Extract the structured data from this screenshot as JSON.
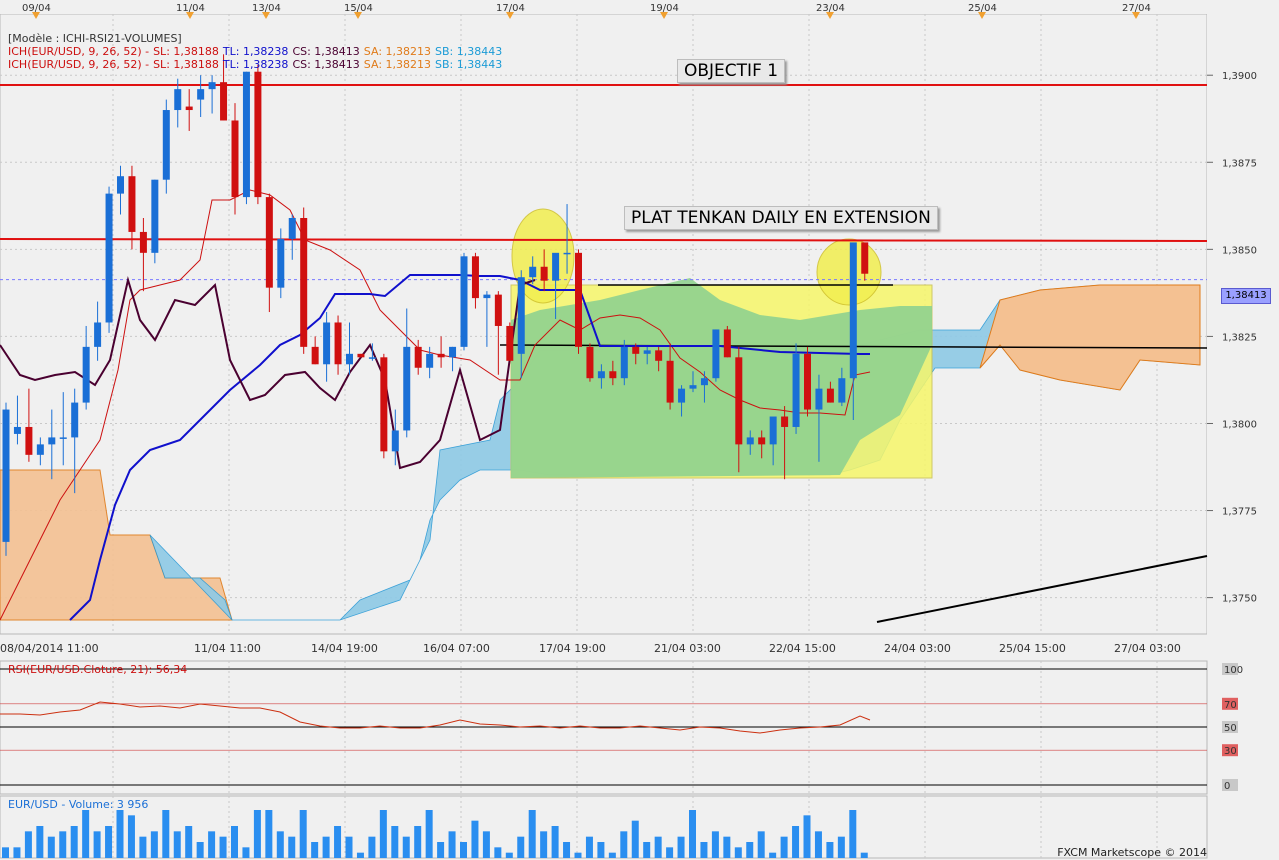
{
  "header": {
    "model": "[Modèle : ICHI-RSI21-VOLUMES]",
    "ich_line": {
      "name": "ICH(EUR/USD, 9, 26, 52) -",
      "sl": "SL: 1,38188",
      "tl": "TL: 1,38238",
      "cs": "CS: 1,38413",
      "sa": "SA: 1,38213",
      "sb": "SB: 1,38443"
    }
  },
  "annotations": {
    "objectif": "OBJECTIF 1",
    "plat_tenkan": "PLAT TENKAN DAILY EN EXTENSION"
  },
  "rsi_label": "RSI(EUR/USD.Cloture, 21): 56,34",
  "volume_label": "EUR/USD - Volume: 3 956",
  "footer": "FXCM Marketscope © 2014",
  "current_price_label": "1,38413",
  "colors": {
    "bull": "#1a6fd6",
    "bear": "#d01010",
    "kumo_bull": "#8ecae6",
    "kumo_bear": "#f4c192",
    "tenkan": "#cc1010",
    "kijun": "#1010cc",
    "chikou": "#4a0030",
    "highlight_yellow": "#f7f76a",
    "highlight_green": "#8fd18f",
    "objective_line": "#e01010"
  },
  "chart_data": [
    {
      "type": "candlestick",
      "top_dates": [
        "09/04",
        "11/04",
        "13/04",
        "15/04",
        "17/04",
        "19/04",
        "23/04",
        "25/04",
        "27/04"
      ],
      "x_tick_labels": [
        "08/04/2014 11:00",
        "11/04 11:00",
        "14/04 19:00",
        "16/04 07:00",
        "17/04 19:00",
        "21/04 03:00",
        "22/04 15:00",
        "24/04 03:00",
        "25/04 15:00",
        "27/04 03:00"
      ],
      "y_tick_labels": [
        "1,3900",
        "1,3875",
        "1,3850",
        "1,3825",
        "1,3800",
        "1,3775",
        "1,3750"
      ],
      "ylim": [
        1.3743,
        1.3917
      ],
      "ohlc": [
        [
          1.3766,
          1.3806,
          1.3762,
          1.3804
        ],
        [
          1.3797,
          1.3808,
          1.3794,
          1.3799
        ],
        [
          1.3799,
          1.381,
          1.3789,
          1.3791
        ],
        [
          1.3791,
          1.3796,
          1.3788,
          1.3794
        ],
        [
          1.3794,
          1.3804,
          1.3784,
          1.3796
        ],
        [
          1.3796,
          1.3809,
          1.3788,
          1.3796
        ],
        [
          1.3796,
          1.381,
          1.378,
          1.3806
        ],
        [
          1.3806,
          1.3828,
          1.3804,
          1.3822
        ],
        [
          1.3822,
          1.3835,
          1.3818,
          1.3829
        ],
        [
          1.3829,
          1.3868,
          1.3826,
          1.3866
        ],
        [
          1.3866,
          1.3874,
          1.386,
          1.3871
        ],
        [
          1.3871,
          1.3874,
          1.385,
          1.3855
        ],
        [
          1.3855,
          1.3859,
          1.3838,
          1.3849
        ],
        [
          1.3849,
          1.387,
          1.3846,
          1.387
        ],
        [
          1.387,
          1.3893,
          1.3866,
          1.389
        ],
        [
          1.389,
          1.3899,
          1.3885,
          1.3896
        ],
        [
          1.3891,
          1.3896,
          1.3884,
          1.389
        ],
        [
          1.3893,
          1.39,
          1.3888,
          1.3896
        ],
        [
          1.3896,
          1.39,
          1.3889,
          1.3898
        ],
        [
          1.3898,
          1.3906,
          1.3887,
          1.3887
        ],
        [
          1.3887,
          1.3892,
          1.386,
          1.3865
        ],
        [
          1.3865,
          1.3901,
          1.3863,
          1.3901
        ],
        [
          1.3901,
          1.3903,
          1.3863,
          1.3865
        ],
        [
          1.3865,
          1.3866,
          1.3832,
          1.3839
        ],
        [
          1.3839,
          1.3856,
          1.3836,
          1.3853
        ],
        [
          1.3853,
          1.386,
          1.3847,
          1.3859
        ],
        [
          1.3859,
          1.3862,
          1.382,
          1.3822
        ],
        [
          1.3822,
          1.3825,
          1.3817,
          1.3817
        ],
        [
          1.3817,
          1.3832,
          1.3812,
          1.3829
        ],
        [
          1.3829,
          1.3831,
          1.3814,
          1.3817
        ],
        [
          1.3817,
          1.3829,
          1.3814,
          1.382
        ],
        [
          1.382,
          1.382,
          1.3819,
          1.3819
        ],
        [
          1.3819,
          1.3823,
          1.3818,
          1.3819
        ],
        [
          1.3819,
          1.382,
          1.379,
          1.3792
        ],
        [
          1.3792,
          1.3804,
          1.3788,
          1.3798
        ],
        [
          1.3798,
          1.3833,
          1.3796,
          1.3822
        ],
        [
          1.3822,
          1.3824,
          1.3814,
          1.3816
        ],
        [
          1.3816,
          1.3822,
          1.3813,
          1.382
        ],
        [
          1.382,
          1.3825,
          1.3816,
          1.3819
        ],
        [
          1.3819,
          1.3822,
          1.3815,
          1.3822
        ],
        [
          1.3822,
          1.3849,
          1.3821,
          1.3848
        ],
        [
          1.3848,
          1.3849,
          1.3833,
          1.3836
        ],
        [
          1.3836,
          1.3838,
          1.3822,
          1.3837
        ],
        [
          1.3837,
          1.3838,
          1.3814,
          1.3828
        ],
        [
          1.3828,
          1.3829,
          1.3818,
          1.3818
        ],
        [
          1.382,
          1.3844,
          1.3813,
          1.3842
        ],
        [
          1.3842,
          1.3848,
          1.384,
          1.3845
        ],
        [
          1.3845,
          1.385,
          1.3838,
          1.3841
        ],
        [
          1.3841,
          1.3848,
          1.383,
          1.3849
        ],
        [
          1.3849,
          1.3863,
          1.3843,
          1.3849
        ],
        [
          1.3849,
          1.385,
          1.382,
          1.3822
        ],
        [
          1.3822,
          1.3823,
          1.3812,
          1.3813
        ],
        [
          1.3813,
          1.3817,
          1.381,
          1.3815
        ],
        [
          1.3815,
          1.3818,
          1.3811,
          1.3813
        ],
        [
          1.3813,
          1.3824,
          1.3811,
          1.3822
        ],
        [
          1.3822,
          1.3823,
          1.3817,
          1.382
        ],
        [
          1.382,
          1.3822,
          1.3817,
          1.3821
        ],
        [
          1.3821,
          1.3822,
          1.3815,
          1.3818
        ],
        [
          1.3818,
          1.3823,
          1.3804,
          1.3806
        ],
        [
          1.3806,
          1.3811,
          1.3802,
          1.381
        ],
        [
          1.381,
          1.3815,
          1.3809,
          1.3811
        ],
        [
          1.3811,
          1.3815,
          1.3806,
          1.3813
        ],
        [
          1.3813,
          1.3827,
          1.3812,
          1.3827
        ],
        [
          1.3827,
          1.3828,
          1.3819,
          1.3819
        ],
        [
          1.3819,
          1.3822,
          1.3786,
          1.3794
        ],
        [
          1.3794,
          1.3798,
          1.3791,
          1.3796
        ],
        [
          1.3796,
          1.3798,
          1.379,
          1.3794
        ],
        [
          1.3794,
          1.38,
          1.3788,
          1.3802
        ],
        [
          1.3802,
          1.3805,
          1.3784,
          1.3799
        ],
        [
          1.3799,
          1.3823,
          1.3797,
          1.382
        ],
        [
          1.382,
          1.3822,
          1.3802,
          1.3804
        ],
        [
          1.3804,
          1.3814,
          1.3789,
          1.381
        ],
        [
          1.381,
          1.3812,
          1.3806,
          1.3806
        ],
        [
          1.3806,
          1.3816,
          1.3805,
          1.3813
        ],
        [
          1.3813,
          1.3847,
          1.3801,
          1.3852
        ],
        [
          1.3852,
          1.3847,
          1.3841,
          1.3843
        ]
      ],
      "annotations": [
        "OBJECTIF 1",
        "PLAT TENKAN DAILY EN EXTENSION"
      ],
      "current_price": 1.38413
    },
    {
      "type": "line",
      "title": "RSI(EUR/USD.Cloture, 21): 56,34",
      "y_tick_labels": [
        "100",
        "70",
        "50",
        "30",
        "0"
      ],
      "ylim": [
        0,
        100
      ],
      "last_value": 56.34
    },
    {
      "type": "bar",
      "title": "EUR/USD - Volume: 3 956",
      "values": [
        2,
        2,
        5,
        6,
        4,
        5,
        6,
        9,
        5,
        6,
        9,
        8,
        4,
        5,
        9,
        5,
        6,
        3,
        5,
        4,
        6,
        2,
        9,
        9,
        5,
        4,
        9,
        3,
        4,
        6,
        4,
        1,
        4,
        9,
        6,
        4,
        6,
        9,
        3,
        5,
        3,
        7,
        5,
        2,
        1,
        4,
        9,
        5,
        6,
        3,
        1,
        4,
        3,
        1,
        5,
        7,
        3,
        4,
        2,
        4,
        9,
        3,
        5,
        4,
        2,
        3,
        5,
        1,
        4,
        6,
        8,
        5,
        3,
        4,
        9,
        1
      ]
    }
  ]
}
